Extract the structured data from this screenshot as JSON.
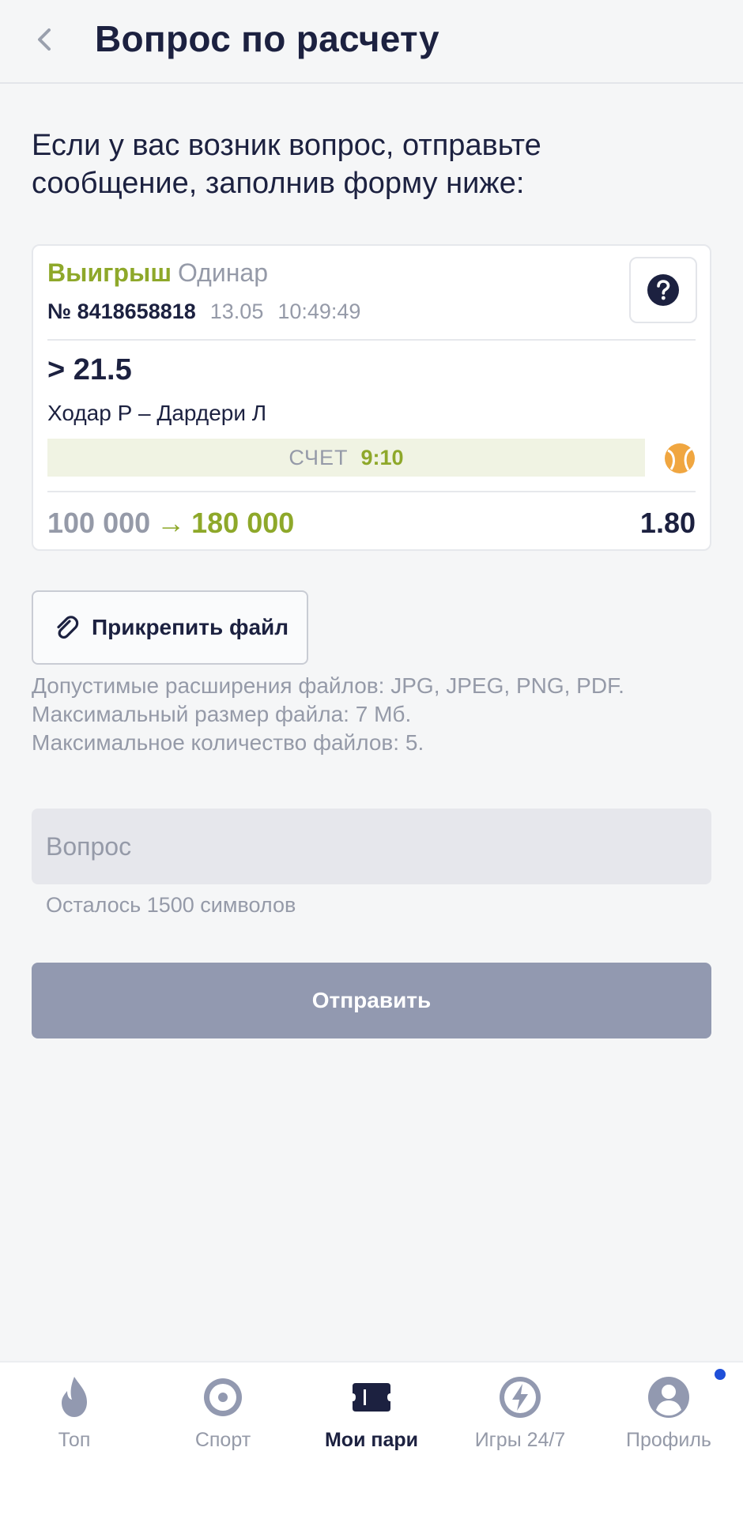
{
  "header": {
    "title": "Вопрос по расчету"
  },
  "intro": {
    "text": "Если у вас возник вопрос, отправьте сообщение, заполнив форму ниже:"
  },
  "bet": {
    "status": "Выигрыш",
    "type": "Одинар",
    "number": "№ 8418658818",
    "date": "13.05",
    "time": "10:49:49",
    "outcome": "> 21.5",
    "event": "Ходар Р – Дардери Л",
    "score_label": "СЧЕТ",
    "score": "9:10",
    "stake": "100 000",
    "arrow": "→",
    "payout": "180 000",
    "odds": "1.80"
  },
  "attach": {
    "button_label": "Прикрепить файл",
    "info_line1_text": "Допустимые расширения файлов: ",
    "info_line1_value": "JPG, JPEG, PNG, PDF",
    "info_line2_text": "Максимальный размер файла: ",
    "info_line2_value": "7 Мб",
    "info_line3_text": "Максимальное количество файлов: ",
    "info_line3_value": "5"
  },
  "form": {
    "question_placeholder": "Вопрос",
    "chars_left": "Осталось 1500 символов",
    "submit_label": "Отправить"
  },
  "tabbar": {
    "items": [
      {
        "label": "Топ",
        "icon": "flame-icon"
      },
      {
        "label": "Спорт",
        "icon": "target-icon"
      },
      {
        "label": "Мои пари",
        "icon": "ticket-icon"
      },
      {
        "label": "Игры 24/7",
        "icon": "lightning-icon"
      },
      {
        "label": "Профиль",
        "icon": "user-icon"
      }
    ]
  },
  "colors": {
    "accent_green": "#8ea82a",
    "text_dark": "#1c2140",
    "text_muted": "#959aa8",
    "submit_disabled": "#9299b0",
    "notification_dot": "#1f4fd8",
    "tennis_ball": "#f0a640"
  }
}
